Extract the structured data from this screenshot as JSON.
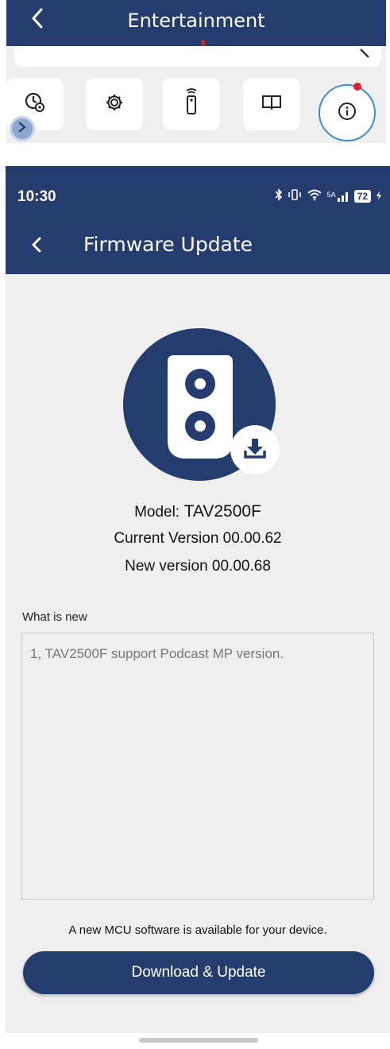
{
  "top_screen": {
    "title": "Entertainment",
    "tiles": [
      {
        "icon": "clock-gear-icon"
      },
      {
        "icon": "gear-icon"
      },
      {
        "icon": "remote-control-icon"
      },
      {
        "icon": "book-icon"
      },
      {
        "icon": "info-icon",
        "selected": true,
        "notification_dot": true
      }
    ],
    "expand_icon": "chevron-right-icon"
  },
  "status_bar": {
    "time": "10:30",
    "icons": [
      "bluetooth-icon",
      "vibrate-icon",
      "wifi-icon",
      "signal-5g-icon"
    ],
    "network_label": "5A",
    "battery": "72"
  },
  "header": {
    "title": "Firmware Update",
    "back_icon": "chevron-left-icon"
  },
  "device": {
    "icon": "speaker-icon",
    "badge_icon": "download-icon",
    "model_label": "Model:",
    "model_value": "TAV2500F",
    "current_version": "Current Version 00.00.62",
    "new_version": "New version 00.00.68"
  },
  "whats_new": {
    "label": "What is new",
    "notes": "1, TAV2500F support Podcast MP version."
  },
  "footer": {
    "message": "A new MCU software is available for your device.",
    "button_label": "Download & Update"
  },
  "colors": {
    "primary": "#243c6e",
    "background": "#efefef",
    "highlight_ring": "#3b8ed0",
    "notification_dot": "#e2202a"
  }
}
